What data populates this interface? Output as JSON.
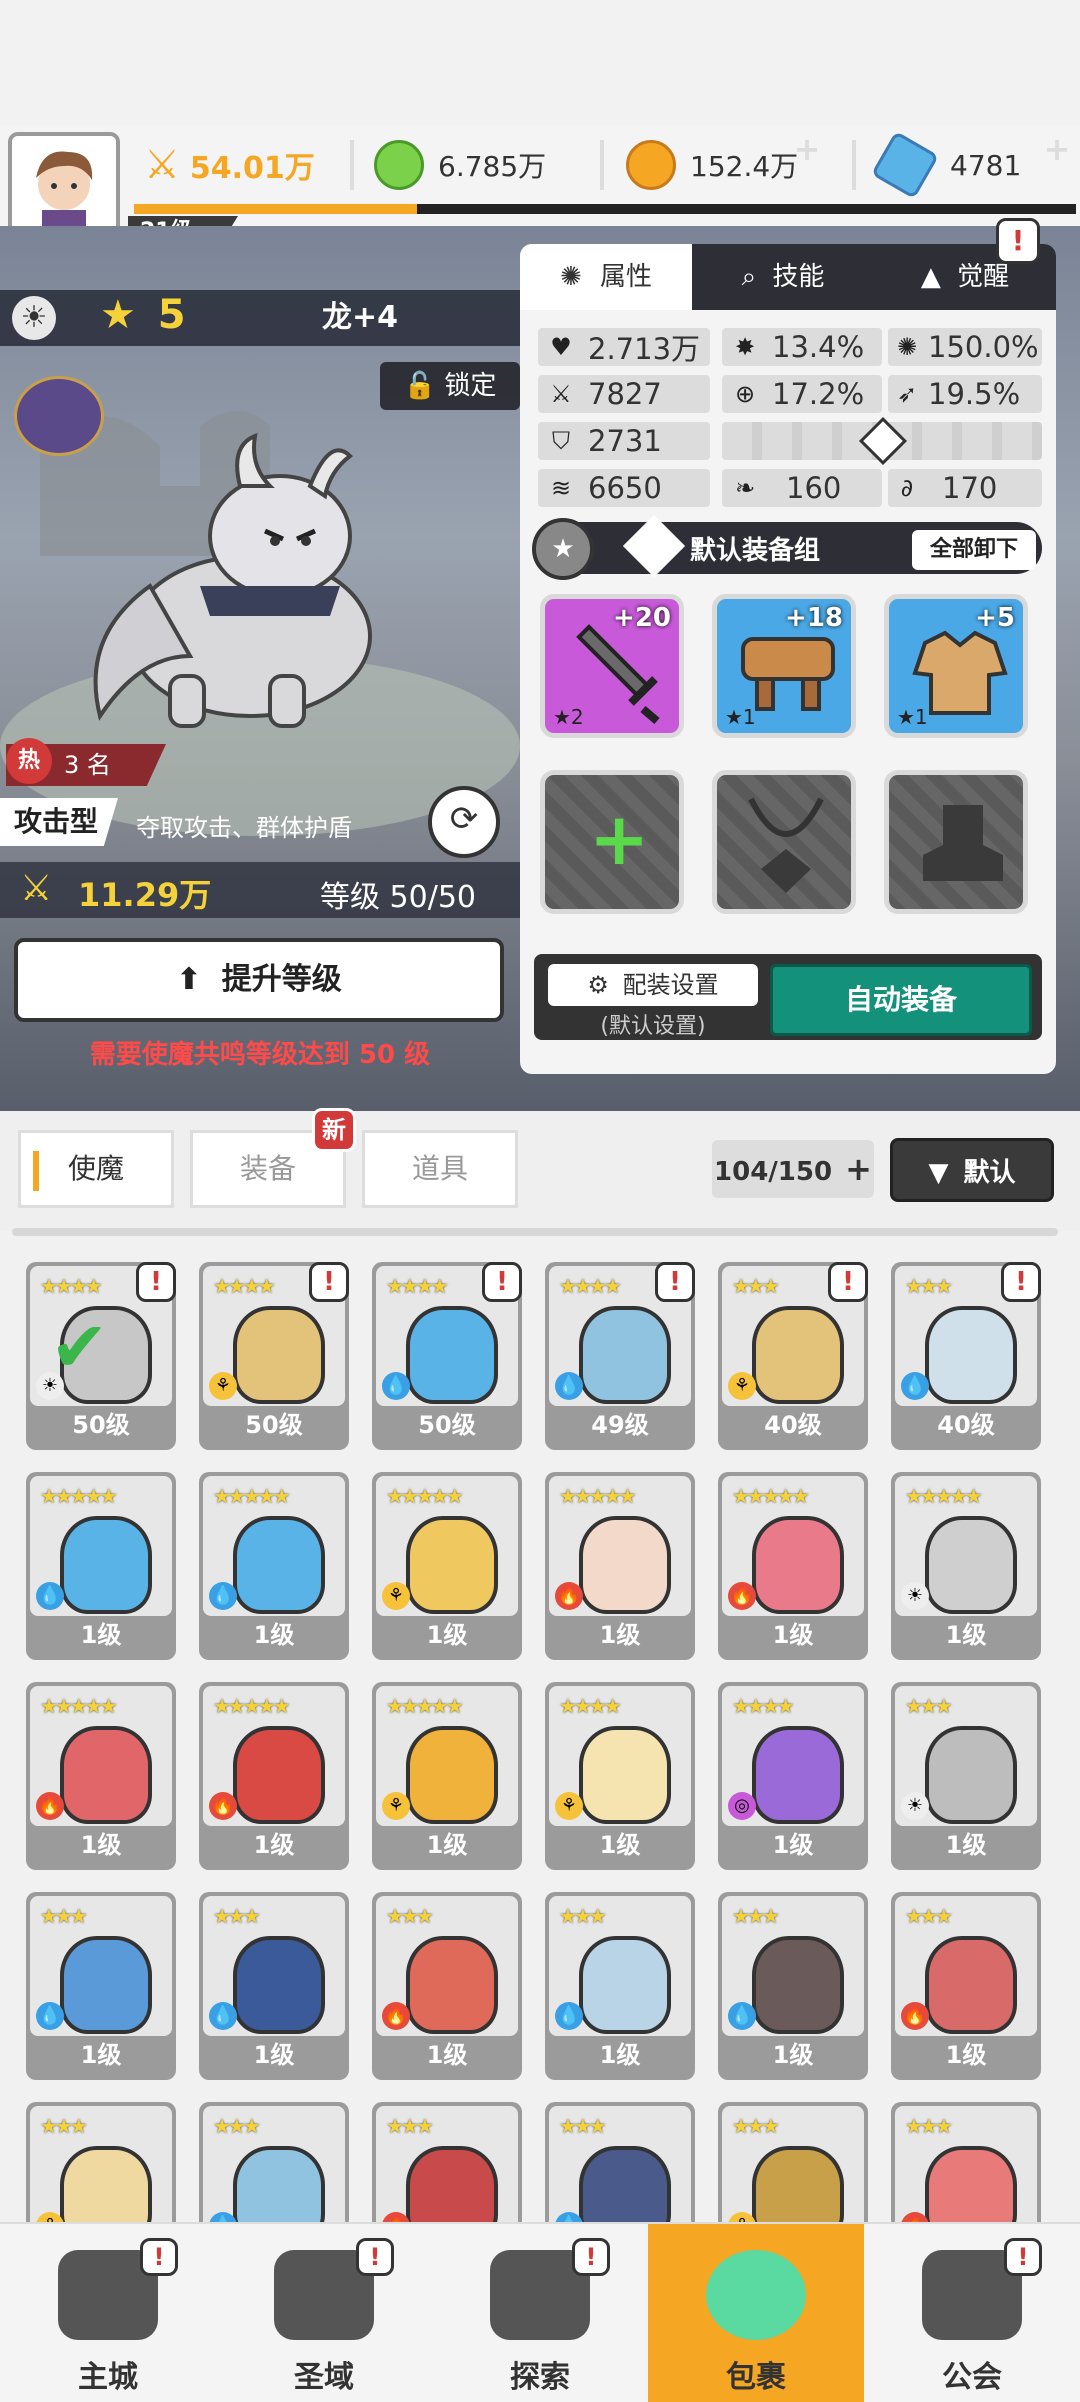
{
  "top": {
    "level": "21级",
    "power": "54.01万",
    "resources": [
      {
        "name": "gem-green",
        "value": "6.785万",
        "color": "#7bd14a"
      },
      {
        "name": "gold-coin",
        "value": "152.4万",
        "color": "#f5a623"
      },
      {
        "name": "crystal",
        "value": "4781",
        "color": "#5ab3e6"
      }
    ],
    "xp_fraction": 0.3
  },
  "hero": {
    "stars": "5",
    "name": "龙+4",
    "lock": "锁定",
    "hot_label": "热",
    "hot_rank": "3 名",
    "type": "攻击型",
    "desc": "夺取攻击、群体护盾",
    "power": "11.29万",
    "level": "等级 50/50",
    "upgrade": "提升等级",
    "warning": "需要使魔共鸣等级达到 50 级"
  },
  "panel": {
    "tabs": [
      "属性",
      "技能",
      "觉醒"
    ],
    "stats": [
      {
        "icon": "heart-icon",
        "glyph": "♥",
        "value": "2.713万"
      },
      {
        "icon": "burst-icon",
        "glyph": "✸",
        "value": "13.4%"
      },
      {
        "icon": "star-burst-icon",
        "glyph": "✺",
        "value": "150.0%"
      },
      {
        "icon": "sword-icon",
        "glyph": "⚔",
        "value": "7827"
      },
      {
        "icon": "target-icon",
        "glyph": "⊕",
        "value": "17.2%"
      },
      {
        "icon": "wing-icon",
        "glyph": "➶",
        "value": "19.5%"
      },
      {
        "icon": "shield-icon",
        "glyph": "⛉",
        "value": "2731"
      },
      {
        "icon": "gust-icon",
        "glyph": "≋",
        "value": "6650"
      },
      {
        "icon": "feather-icon",
        "glyph": "❧",
        "value": "160"
      },
      {
        "icon": "swirl-icon",
        "glyph": "∂",
        "value": "170"
      }
    ],
    "equip_group": "默认装备组",
    "unequip_all": "全部卸下",
    "slots": [
      {
        "plus": "+20",
        "stars": "★2",
        "color": "#c85ad9"
      },
      {
        "plus": "+18",
        "stars": "★1",
        "color": "#4aa8e6"
      },
      {
        "plus": "+5",
        "stars": "★1",
        "color": "#4aa8e6"
      }
    ],
    "config": "配装设置",
    "config_sub": "(默认设置)",
    "auto_equip": "自动装备"
  },
  "inventory": {
    "tabs": [
      "使魔",
      "装备",
      "道具"
    ],
    "new_badge": "新",
    "count": "104/150",
    "sort": "默认",
    "cards": [
      {
        "lvl": "50级",
        "stars": "★★★★",
        "color": "#c7c7c7",
        "el": "☀",
        "elc": "#eee",
        "excl": true
      },
      {
        "lvl": "50级",
        "stars": "★★★★",
        "color": "#e3c27a",
        "el": "⚘",
        "elc": "#f5c23a",
        "excl": true
      },
      {
        "lvl": "50级",
        "stars": "★★★★",
        "color": "#5ab3e6",
        "el": "💧",
        "elc": "#3aa0e6",
        "excl": true
      },
      {
        "lvl": "49级",
        "stars": "★★★★",
        "color": "#8fc3e0",
        "el": "💧",
        "elc": "#3aa0e6",
        "excl": true
      },
      {
        "lvl": "40级",
        "stars": "★★★",
        "color": "#e3c27a",
        "el": "⚘",
        "elc": "#f5c23a",
        "excl": true
      },
      {
        "lvl": "40级",
        "stars": "★★★",
        "color": "#cfe0ea",
        "el": "💧",
        "elc": "#3aa0e6",
        "excl": true
      },
      {
        "lvl": "1级",
        "stars": "★★★★★",
        "color": "#5ab3e6",
        "el": "💧",
        "elc": "#3aa0e6",
        "excl": false
      },
      {
        "lvl": "1级",
        "stars": "★★★★★",
        "color": "#5ab3e6",
        "el": "💧",
        "elc": "#3aa0e6",
        "excl": false
      },
      {
        "lvl": "1级",
        "stars": "★★★★★",
        "color": "#f0c860",
        "el": "⚘",
        "elc": "#f5c23a",
        "excl": false
      },
      {
        "lvl": "1级",
        "stars": "★★★★★",
        "color": "#f3d9c9",
        "el": "🔥",
        "elc": "#e64a3a",
        "excl": false
      },
      {
        "lvl": "1级",
        "stars": "★★★★★",
        "color": "#e87a8a",
        "el": "🔥",
        "elc": "#e64a3a",
        "excl": false
      },
      {
        "lvl": "1级",
        "stars": "★★★★★",
        "color": "#cfcfcf",
        "el": "☀",
        "elc": "#eee",
        "excl": false
      },
      {
        "lvl": "1级",
        "stars": "★★★★★",
        "color": "#e0666a",
        "el": "🔥",
        "elc": "#e64a3a",
        "excl": false
      },
      {
        "lvl": "1级",
        "stars": "★★★★★",
        "color": "#d94a44",
        "el": "🔥",
        "elc": "#e64a3a",
        "excl": false
      },
      {
        "lvl": "1级",
        "stars": "★★★★★",
        "color": "#f0b23a",
        "el": "⚘",
        "elc": "#f5c23a",
        "excl": false
      },
      {
        "lvl": "1级",
        "stars": "★★★★",
        "color": "#f5e3b0",
        "el": "⚘",
        "elc": "#f5c23a",
        "excl": false
      },
      {
        "lvl": "1级",
        "stars": "★★★★",
        "color": "#9a6ad9",
        "el": "◎",
        "elc": "#c85ad9",
        "excl": false
      },
      {
        "lvl": "1级",
        "stars": "★★★",
        "color": "#bdbdbd",
        "el": "☀",
        "elc": "#eee",
        "excl": false
      },
      {
        "lvl": "1级",
        "stars": "★★★",
        "color": "#5a9ad9",
        "el": "💧",
        "elc": "#3aa0e6",
        "excl": false
      },
      {
        "lvl": "1级",
        "stars": "★★★",
        "color": "#3a5a9a",
        "el": "💧",
        "elc": "#3aa0e6",
        "excl": false
      },
      {
        "lvl": "1级",
        "stars": "★★★",
        "color": "#e06a5a",
        "el": "🔥",
        "elc": "#e64a3a",
        "excl": false
      },
      {
        "lvl": "1级",
        "stars": "★★★",
        "color": "#b9d4e6",
        "el": "💧",
        "elc": "#3aa0e6",
        "excl": false
      },
      {
        "lvl": "1级",
        "stars": "★★★",
        "color": "#6a5a5a",
        "el": "💧",
        "elc": "#3aa0e6",
        "excl": false
      },
      {
        "lvl": "1级",
        "stars": "★★★",
        "color": "#d96a6a",
        "el": "🔥",
        "elc": "#e64a3a",
        "excl": false
      },
      {
        "lvl": "",
        "stars": "★★★",
        "color": "#f0d9a0",
        "el": "⚘",
        "elc": "#f5c23a",
        "excl": false
      },
      {
        "lvl": "",
        "stars": "★★★",
        "color": "#8fc3e0",
        "el": "💧",
        "elc": "#3aa0e6",
        "excl": false
      },
      {
        "lvl": "",
        "stars": "★★★",
        "color": "#c94a4a",
        "el": "🔥",
        "elc": "#e64a3a",
        "excl": false
      },
      {
        "lvl": "",
        "stars": "★★★",
        "color": "#4a5a8a",
        "el": "💧",
        "elc": "#3aa0e6",
        "excl": false
      },
      {
        "lvl": "",
        "stars": "★★★",
        "color": "#c9a04a",
        "el": "⚘",
        "elc": "#f5c23a",
        "excl": false
      },
      {
        "lvl": "",
        "stars": "★★★",
        "color": "#e87a7a",
        "el": "🔥",
        "elc": "#e64a3a",
        "excl": false
      }
    ]
  },
  "nav": [
    {
      "label": "主城",
      "icon": "castle-icon",
      "excl": true
    },
    {
      "label": "圣域",
      "icon": "vortex-icon",
      "excl": true
    },
    {
      "label": "探索",
      "icon": "sword-stone-icon",
      "excl": true
    },
    {
      "label": "包裹",
      "icon": "backpack-icon",
      "excl": false,
      "active": true
    },
    {
      "label": "公会",
      "icon": "guild-icon",
      "excl": true
    }
  ]
}
